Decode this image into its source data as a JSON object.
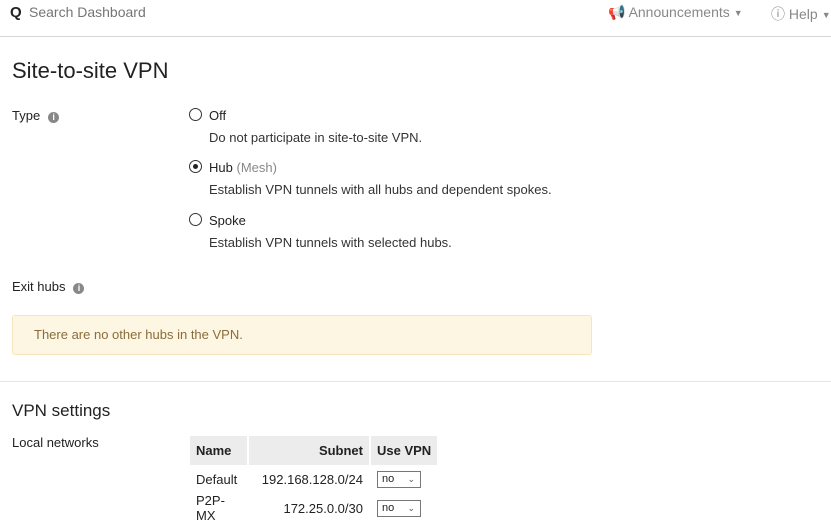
{
  "topbar": {
    "search_placeholder": "Search Dashboard",
    "announcements": "Announcements",
    "help": "Help"
  },
  "page_title": "Site-to-site VPN",
  "type": {
    "label": "Type",
    "options": [
      {
        "label": "Off",
        "suffix": "",
        "description": "Do not participate in site-to-site VPN.",
        "selected": false
      },
      {
        "label": "Hub",
        "suffix": "(Mesh)",
        "description": "Establish VPN tunnels with all hubs and dependent spokes.",
        "selected": true
      },
      {
        "label": "Spoke",
        "suffix": "",
        "description": "Establish VPN tunnels with selected hubs.",
        "selected": false
      }
    ]
  },
  "exit_hubs": {
    "label": "Exit hubs",
    "alert": "There are no other hubs in the VPN."
  },
  "vpn_settings": {
    "title": "VPN settings",
    "local_networks_label": "Local networks",
    "columns": [
      "Name",
      "Subnet",
      "Use VPN"
    ],
    "rows": [
      {
        "name": "Default",
        "subnet": "192.168.128.0/24",
        "use_vpn": "no"
      },
      {
        "name": "P2P-MX",
        "subnet": "172.25.0.0/30",
        "use_vpn": "no"
      }
    ]
  }
}
